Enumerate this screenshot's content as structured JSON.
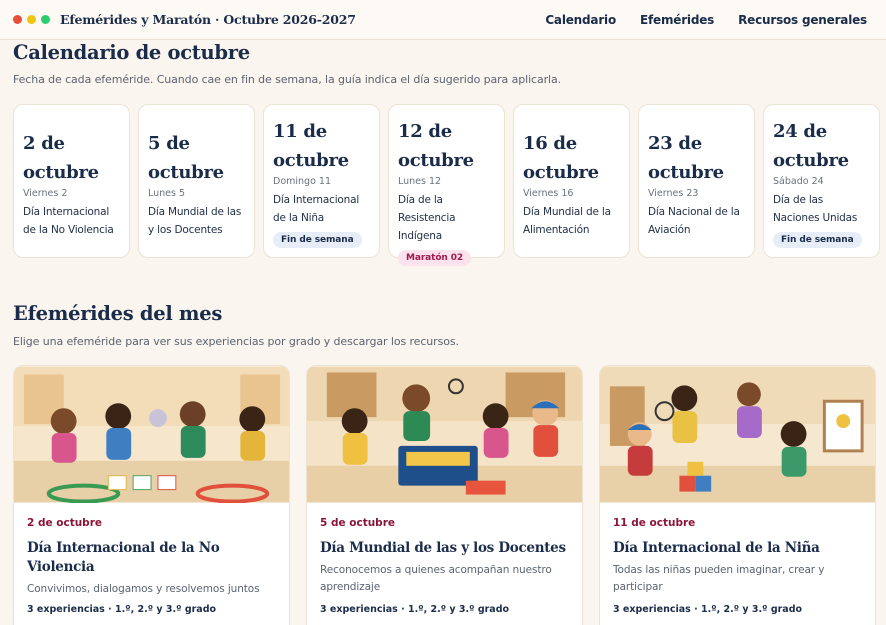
{
  "header": {
    "brand": "Efemérides y Maratón · Octubre 2026-2027",
    "window_dots": [
      "#e74c3c",
      "#f1c40f",
      "#2ecc71"
    ],
    "nav": [
      "Calendario",
      "Efemérides",
      "Recursos generales"
    ]
  },
  "calendar": {
    "title": "Calendario de octubre",
    "subtitle": "Fecha de cada efeméride. Cuando cae en fin de semana, la guía indica el día sugerido para aplicarla.",
    "items": [
      {
        "date": "2 de octubre",
        "weekday": "Viernes 2",
        "name": "Día Internacional de la No Violencia",
        "badge": ""
      },
      {
        "date": "5 de octubre",
        "weekday": "Lunes 5",
        "name": "Día Mundial de las y los Docentes",
        "badge": ""
      },
      {
        "date": "11 de octubre",
        "weekday": "Domingo 11",
        "name": "Día Internacional de la Niña",
        "badge": "Fin de semana"
      },
      {
        "date": "12 de octubre",
        "weekday": "Lunes 12",
        "name": "Día de la Resistencia Indígena",
        "badge": "Maratón 02"
      },
      {
        "date": "16 de octubre",
        "weekday": "Viernes 16",
        "name": "Día Mundial de la Alimentación",
        "badge": ""
      },
      {
        "date": "23 de octubre",
        "weekday": "Viernes 23",
        "name": "Día Nacional de la Aviación",
        "badge": ""
      },
      {
        "date": "24 de octubre",
        "weekday": "Sábado 24",
        "name": "Día de las Naciones Unidas",
        "badge": "Fin de semana"
      }
    ]
  },
  "ephemerides": {
    "title": "Efemérides del mes",
    "subtitle": "Elige una efeméride para ver sus experiencias por grado y descargar los recursos.",
    "cards": [
      {
        "date": "2 de octubre",
        "title": "Día Internacional de la No Violencia",
        "description": "Convivimos, dialogamos y resolvemos juntos",
        "meta": "3 experiencias · 1.º, 2.º y 3.º grado",
        "image_icon": "children-circle-illustration"
      },
      {
        "date": "5 de octubre",
        "title": "Día Mundial de las y los Docentes",
        "description": "Reconocemos a quienes acompañan nuestro aprendizaje",
        "meta": "3 experiencias · 1.º, 2.º y 3.º grado",
        "image_icon": "children-teacher-illustration"
      },
      {
        "date": "11 de octubre",
        "title": "Día Internacional de la Niña",
        "description": "Todas las niñas pueden imaginar, crear y participar",
        "meta": "3 experiencias · 1.º, 2.º y 3.º grado",
        "image_icon": "girls-playing-illustration"
      }
    ]
  },
  "colors": {
    "accent": "#8a1538",
    "navy": "#1b2c4a",
    "background": "#faf5ee"
  }
}
